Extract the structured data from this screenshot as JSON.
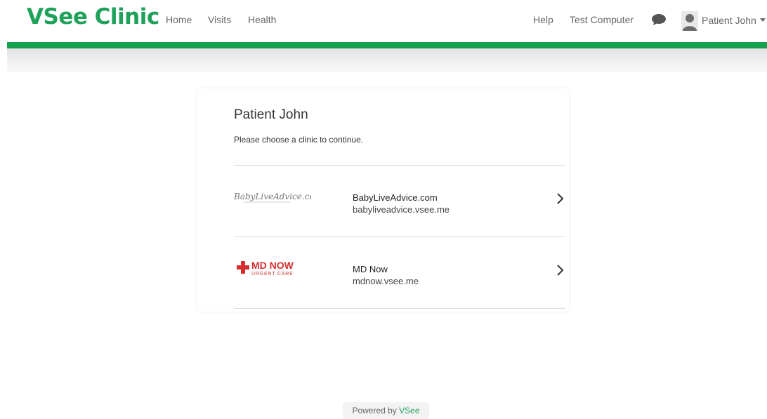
{
  "header": {
    "brand": "VSee Clinic",
    "nav": [
      {
        "label": "Home"
      },
      {
        "label": "Visits"
      },
      {
        "label": "Health"
      }
    ],
    "right": {
      "help": "Help",
      "test_computer": "Test Computer",
      "chat_icon": "chat-bubble-icon",
      "user_name": "Patient John"
    }
  },
  "card": {
    "title": "Patient John",
    "subtitle": "Please choose a clinic to continue.",
    "clinics": [
      {
        "name": "BabyLiveAdvice.com",
        "domain": "babyliveadvice.vsee.me",
        "logo_text": "BabyLiveAdvice.com"
      },
      {
        "name": "MD Now",
        "domain": "mdnow.vsee.me",
        "logo_text": "MD NOW",
        "logo_sub": "URGENT CARE"
      }
    ]
  },
  "footer": {
    "prefix": "Powered by",
    "brand": "VSee"
  },
  "colors": {
    "brand_green": "#1fa15a",
    "accent_bar": "#16a14e",
    "mdnow_red": "#d32f2f"
  }
}
